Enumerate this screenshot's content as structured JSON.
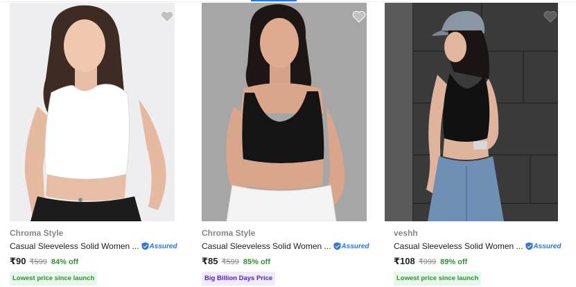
{
  "products": [
    {
      "brand": "Chroma Style",
      "title": "Casual Sleeveless Solid Women ...",
      "assured": "Assured",
      "price": "₹90",
      "mrp": "₹599",
      "discount": "84% off",
      "tag": "Lowest price since launch",
      "tag_color": "#388e3c",
      "image_subject": "woman in white crop tank top"
    },
    {
      "brand": "Chroma Style",
      "title": "Casual Sleeveless Solid Women ...",
      "assured": "Assured",
      "price": "₹85",
      "mrp": "₹599",
      "discount": "85% off",
      "tag": "Big Billion Days Price",
      "tag_color": "#4a2ab3",
      "image_subject": "woman in black crop tank top"
    },
    {
      "brand": "veshh",
      "title": "Casual Sleeveless Solid Women ...",
      "assured": "Assured",
      "price": "₹108",
      "mrp": "₹999",
      "discount": "89% off",
      "tag": "Lowest price since launch",
      "tag_color": "#388e3c",
      "image_subject": "woman in black halter crop top and cap"
    }
  ],
  "icons": {
    "wishlist": "heart-icon",
    "assured": "shield-icon"
  },
  "colors": {
    "accent": "#2874f0",
    "discount": "#388e3c",
    "wishlist": "#c2c2c2"
  }
}
